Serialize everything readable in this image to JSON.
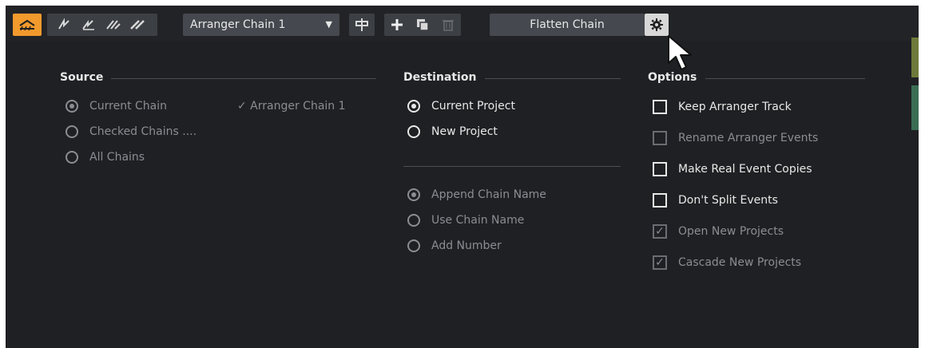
{
  "toolbar": {
    "chain_select_value": "Arranger Chain 1",
    "flatten_label": "Flatten Chain"
  },
  "source": {
    "title": "Source",
    "options": [
      {
        "label": "Current Chain",
        "checked": true
      },
      {
        "label": "Checked Chains ....",
        "checked": false
      },
      {
        "label": "All Chains",
        "checked": false
      }
    ],
    "current_chain_name": "✓ Arranger Chain 1"
  },
  "destination": {
    "title": "Destination",
    "options": [
      {
        "label": "Current Project",
        "checked": true
      },
      {
        "label": "New Project",
        "checked": false
      }
    ],
    "naming": [
      {
        "label": "Append Chain Name",
        "checked": true
      },
      {
        "label": "Use Chain Name",
        "checked": false
      },
      {
        "label": "Add Number",
        "checked": false
      }
    ]
  },
  "options": {
    "title": "Options",
    "items": [
      {
        "label": "Keep Arranger Track",
        "checked": false,
        "enabled": true
      },
      {
        "label": "Rename Arranger Events",
        "checked": false,
        "enabled": false
      },
      {
        "label": "Make Real Event Copies",
        "checked": false,
        "enabled": true
      },
      {
        "label": "Don't Split Events",
        "checked": false,
        "enabled": true
      },
      {
        "label": "Open New Projects",
        "checked": true,
        "enabled": false
      },
      {
        "label": "Cascade New Projects",
        "checked": true,
        "enabled": false
      }
    ]
  },
  "colors": {
    "panel_bg": "#1f2023",
    "accent_orange": "#f39a2d",
    "text": "#e8e8e8",
    "text_dim": "#8a8d92"
  }
}
